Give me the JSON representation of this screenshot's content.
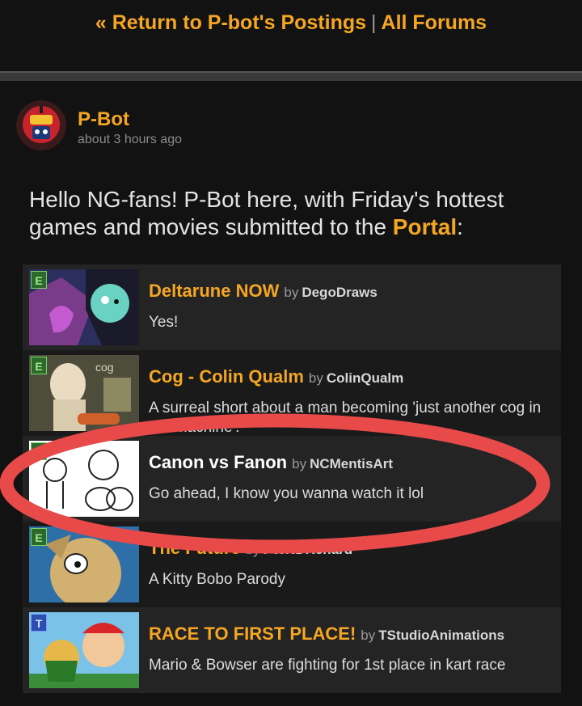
{
  "nav": {
    "back_label": "« Return to P-bot's Postings",
    "separator": "|",
    "forums_label": "All Forums"
  },
  "post": {
    "author": "P-Bot",
    "timestamp": "about 3 hours ago",
    "intro_before": "Hello NG-fans! P-Bot here, with Friday's hottest games and movies submitted to the ",
    "intro_link": "Portal",
    "intro_after": ":",
    "entries": [
      {
        "rating": "E",
        "title": "Deltarune NOW",
        "by": "by",
        "author": "DegoDraws",
        "description": "Yes!"
      },
      {
        "rating": "E",
        "title": "Cog - Colin Qualm",
        "by": "by",
        "author": "ColinQualm",
        "description": "A surreal short about a man becoming 'just another cog in the machine'."
      },
      {
        "rating": "E",
        "title": "Canon vs Fanon",
        "by": "by",
        "author": "NCMentisArt",
        "description": "Go ahead, I know you wanna watch it lol"
      },
      {
        "rating": "E",
        "title": "The Future",
        "by": "by",
        "author": "PWNDRenard",
        "description": "A Kitty Bobo Parody"
      },
      {
        "rating": "T",
        "title": "RACE TO FIRST PLACE!",
        "by": "by",
        "author": "TStudioAnimations",
        "description": "Mario & Bowser are fighting for 1st place in kart race"
      }
    ]
  },
  "annotation": {
    "color": "#e84a4a"
  },
  "colors": {
    "accent": "#f5a623",
    "background": "#121212",
    "row": "#242424"
  }
}
